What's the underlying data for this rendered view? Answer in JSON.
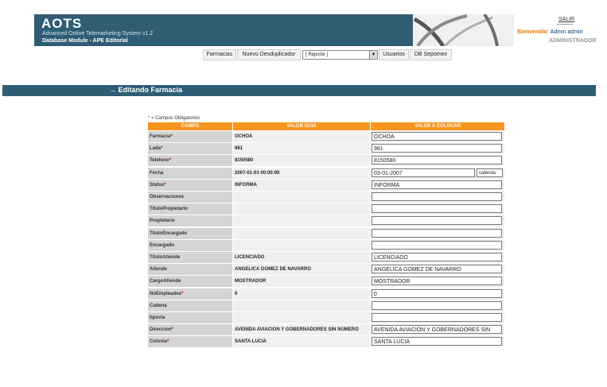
{
  "header": {
    "title": "AOTS",
    "subtitle": "Advanced Online Telemarketing System v1.2",
    "module": "Database Module - APE Editorial"
  },
  "user": {
    "logout_label": "SALIR",
    "welcome_label": "Bienvenido:",
    "username": "Admin admin",
    "role": "ADMINISTRADOR"
  },
  "nav": {
    "farmacias": "Farmacias",
    "desduplicador": "Nuevo Desduplicador",
    "reporte": "[ Reporte ]",
    "usuarios": "Usuarios",
    "sepomex": "DB Sepomex"
  },
  "section_title": "Editando Farmacia",
  "required_note": "= Campos Obligatorios",
  "table": {
    "headers": [
      "CAMPO",
      "VALOR GUIA",
      "VALOR A COLOCAR"
    ],
    "calendar_label": "calenda",
    "rows": [
      {
        "field": "Farmacia",
        "req": "*",
        "guide": "OCHOA",
        "value": "OCHOA"
      },
      {
        "field": "Lada",
        "req": "*",
        "guide": "981",
        "value": "981"
      },
      {
        "field": "Telefono",
        "req": "*",
        "guide": "8150580",
        "value": "8150580"
      },
      {
        "field": "Fecha",
        "req": "",
        "guide": "2007-01-03 00:00:00",
        "value": "03-01-2007"
      },
      {
        "field": "Status",
        "req": "*",
        "guide": "INFORMA",
        "value": "INFORMA"
      },
      {
        "field": "Observaciones",
        "req": "",
        "guide": "",
        "value": ""
      },
      {
        "field": "TituloPropietario",
        "req": "",
        "guide": "",
        "value": ""
      },
      {
        "field": "Propietario",
        "req": "",
        "guide": "",
        "value": ""
      },
      {
        "field": "TituloEncargado",
        "req": "",
        "guide": "",
        "value": ""
      },
      {
        "field": "Encargado",
        "req": "",
        "guide": "",
        "value": ""
      },
      {
        "field": "TituloAtiende",
        "req": "",
        "guide": "LICENCIADO",
        "value": "LICENCIADO"
      },
      {
        "field": "Atiende",
        "req": "",
        "guide": "ANGELICA GOMEZ DE NAVARRO",
        "value": "ANGELICA GOMEZ DE NAVARRO"
      },
      {
        "field": "CargoAtiende",
        "req": "",
        "guide": "MOSTRADOR",
        "value": "MOSTRADOR"
      },
      {
        "field": "NoEmpleados",
        "req": "*",
        "guide": "0",
        "value": "0"
      },
      {
        "field": "Cadena",
        "req": "",
        "guide": "",
        "value": ""
      },
      {
        "field": "tipovia",
        "req": "",
        "guide": "",
        "value": ""
      },
      {
        "field": "Direccion",
        "req": "*",
        "guide": "AVENIDA AVIACION Y GOBERNADORES SIN NUMERO",
        "value": "AVENIDA AVIACION Y GOBERNADORES SIN"
      },
      {
        "field": "Colonia",
        "req": "*",
        "guide": "SANTA LUCIA",
        "value": "SANTA LUCIA"
      }
    ]
  }
}
